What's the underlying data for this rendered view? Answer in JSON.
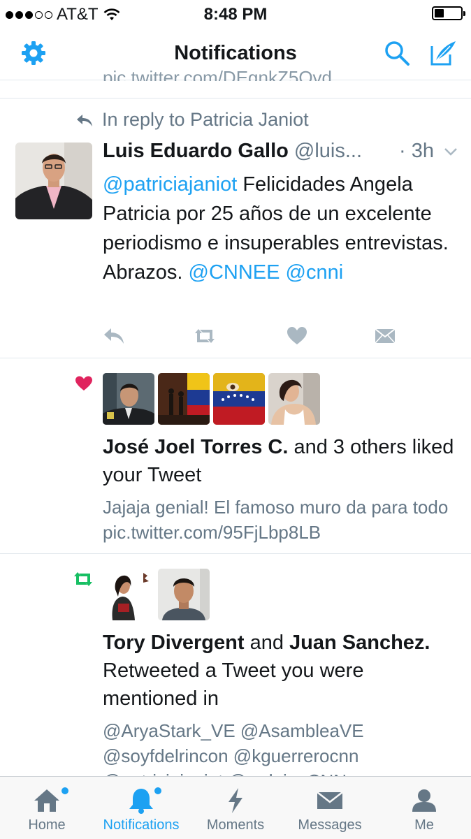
{
  "status": {
    "carrier": "AT&T",
    "time": "8:48 PM"
  },
  "nav": {
    "title": "Notifications"
  },
  "peek_text": "pic.twitter.com/DEgnkZ5Ovd",
  "tweet": {
    "reply_context": "In reply to Patricia Janiot",
    "name": "Luis Eduardo Gallo",
    "handle": "@luis...",
    "time": "· 3h",
    "mention": "@patriciajaniot",
    "text_main": " Felicidades Angela Patricia por 25 años de un excelente periodismo e insuperables entrevistas. Abrazos. ",
    "tag1": "@CNNEE",
    "tag2": "@cnni"
  },
  "like_notif": {
    "actor": "José Joel Torres C.",
    "rest": " and 3 others liked your Tweet",
    "tweet_text": "Jajaja genial! El famoso muro da para todo pic.twitter.com/95FjLbp8LB"
  },
  "rt_notif": {
    "actor1": "Tory Divergent",
    "and": " and ",
    "actor2": "Juan Sanchez.",
    "rest": " Retweeted a Tweet you were mentioned in",
    "line1": "@AryaStark_VE @AsambleaVE",
    "line2": "@soyfdelrincon @kguerrerocnn",
    "line3": "@patriciajaniot @arduinoCNN"
  },
  "tabs": [
    {
      "label": "Home"
    },
    {
      "label": "Notifications"
    },
    {
      "label": "Moments"
    },
    {
      "label": "Messages"
    },
    {
      "label": "Me"
    }
  ],
  "colors": {
    "accent": "#1da1f2",
    "like": "#e0245e",
    "retweet": "#17bf63",
    "secondary": "#657786"
  }
}
